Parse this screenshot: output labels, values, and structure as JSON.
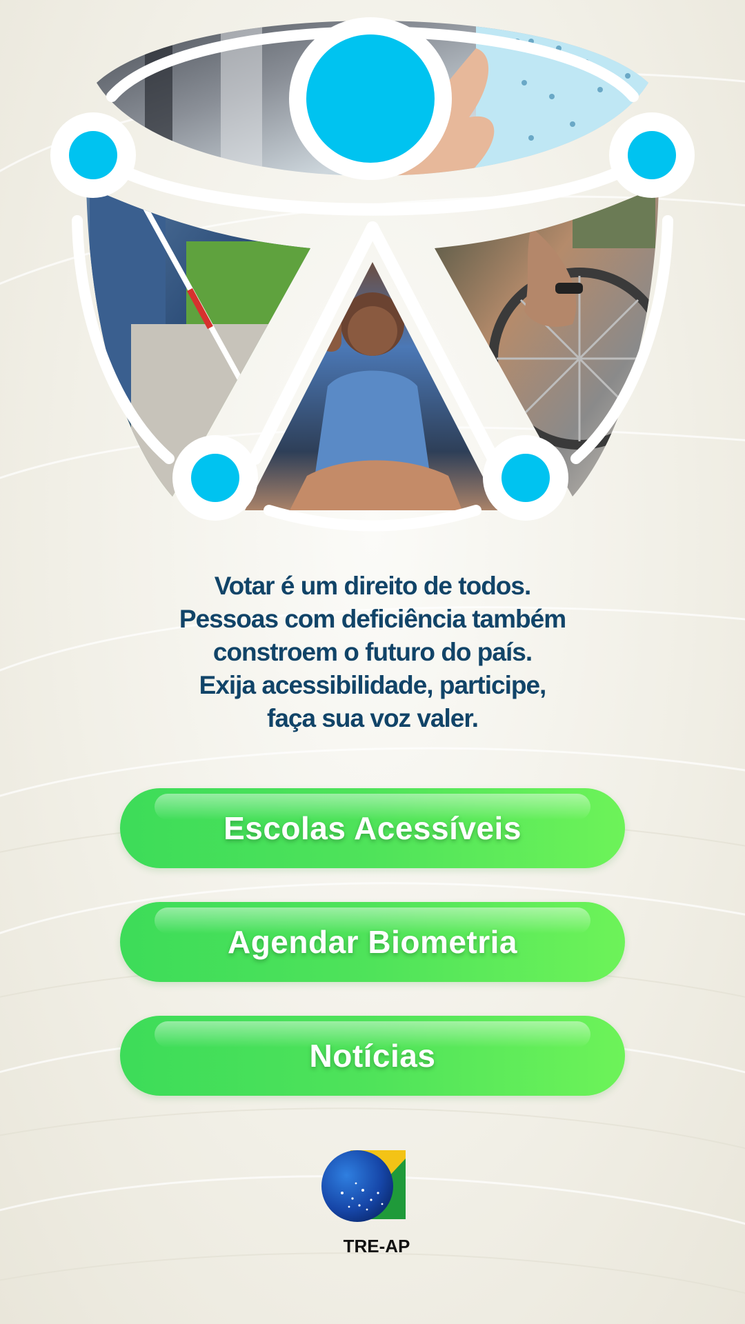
{
  "message": {
    "lines": [
      "Votar é um direito de todos.",
      "Pessoas com deficiência também",
      "constroem o futuro do país.",
      "Exija acessibilidade, participe,",
      "faça sua voz valer."
    ]
  },
  "buttons": {
    "schools": "Escolas Acessíveis",
    "biometrics": "Agendar Biometria",
    "news": "Notícias"
  },
  "logo": {
    "text": "TRE-AP"
  },
  "colors": {
    "accent_cyan": "#00c3f0",
    "text_blue": "#114468",
    "button_green": "#4fe35a"
  }
}
